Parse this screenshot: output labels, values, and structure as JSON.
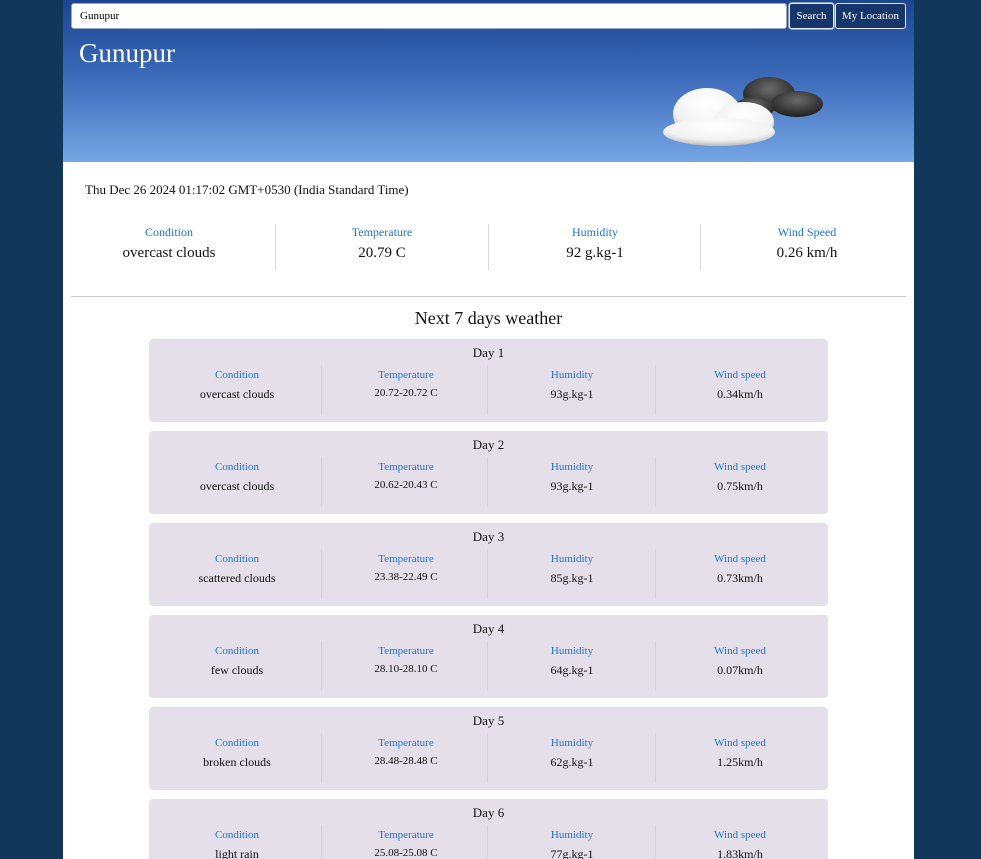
{
  "search": {
    "value": "Gunupur",
    "button_label": "Search",
    "location_button_label": "My Location"
  },
  "current": {
    "city": "Gunupur",
    "icon": "cloud-icon",
    "datetime": "Thu Dec 26 2024 01:17:02 GMT+0530 (India Standard Time)",
    "stats": [
      {
        "label": "Condition",
        "value": "overcast clouds"
      },
      {
        "label": "Temperature",
        "value": "20.79 C"
      },
      {
        "label": "Humidity",
        "value": "92 g.kg-1"
      },
      {
        "label": "Wind Speed",
        "value": "0.26 km/h"
      }
    ]
  },
  "forecast": {
    "title": "Next 7 days weather",
    "labels": {
      "condition": "Condition",
      "temperature": "Temperature",
      "humidity": "Humidity",
      "wind": "Wind speed"
    },
    "days": [
      {
        "title": "Day 1",
        "condition": "overcast clouds",
        "temperature": "20.72-20.72 C",
        "humidity": "93g.kg-1",
        "wind": "0.34km/h"
      },
      {
        "title": "Day 2",
        "condition": "overcast clouds",
        "temperature": "20.62-20.43 C",
        "humidity": "93g.kg-1",
        "wind": "0.75km/h"
      },
      {
        "title": "Day 3",
        "condition": "scattered clouds",
        "temperature": "23.38-22.49 C",
        "humidity": "85g.kg-1",
        "wind": "0.73km/h"
      },
      {
        "title": "Day 4",
        "condition": "few clouds",
        "temperature": "28.10-28.10 C",
        "humidity": "64g.kg-1",
        "wind": "0.07km/h"
      },
      {
        "title": "Day 5",
        "condition": "broken clouds",
        "temperature": "28.48-28.48 C",
        "humidity": "62g.kg-1",
        "wind": "1.25km/h"
      },
      {
        "title": "Day 6",
        "condition": "light rain",
        "temperature": "25.08-25.08 C",
        "humidity": "77g.kg-1",
        "wind": "1.83km/h"
      }
    ]
  },
  "colors": {
    "background": "#11375a",
    "header_top": "#1b4590",
    "header_bottom": "#76a6e4",
    "accent": "#1a73d9",
    "card": "#e4dfe8",
    "button": "#15356b"
  }
}
